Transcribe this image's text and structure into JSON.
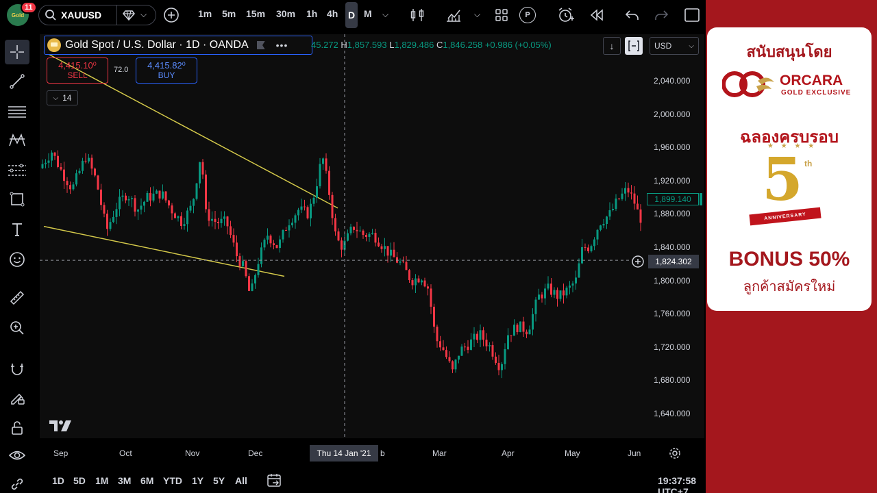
{
  "topbar": {
    "notification_count": "11",
    "avatar_text": "Gold",
    "symbol": "XAUUSD",
    "intervals": [
      "1m",
      "5m",
      "15m",
      "30m",
      "1h",
      "4h",
      "D",
      "M"
    ],
    "active_interval": "D",
    "p_label": "P"
  },
  "legend": {
    "title": "Gold Spot / U.S. Dollar · 1D · OANDA",
    "ohlc_prefix": "45.272",
    "h_label": "H",
    "h_value": "1,857.593",
    "l_label": "L",
    "l_value": "1,829.486",
    "c_label": "C",
    "c_value": "1,846.258",
    "change": "+0.986 (+0.05%)"
  },
  "trade": {
    "sell_price": "4,415.10⁰",
    "sell_label": "SELL",
    "spread": "72.0",
    "buy_price": "4,415.82⁰",
    "buy_label": "BUY",
    "collapsed_count": "14"
  },
  "currency": "USD",
  "chart_data": {
    "type": "candlestick",
    "symbol": "XAUUSD",
    "y_ticks": [
      "2,040.000",
      "2,000.000",
      "1,960.000",
      "1,920.000",
      "1,880.000",
      "1,840.000",
      "1,800.000",
      "1,760.000",
      "1,720.000",
      "1,680.000",
      "1,640.000"
    ],
    "ylim": [
      1610,
      2080
    ],
    "x_ticks": [
      "Sep",
      "Oct",
      "Nov",
      "Dec",
      "Jan",
      "Feb",
      "Mar",
      "Apr",
      "May",
      "Jun"
    ],
    "current_price": "1,899.140",
    "crosshair_price": "1,824.302",
    "crosshair_date": "Thu 14 Jan '21",
    "colors": {
      "up": "#089981",
      "down": "#f23645",
      "trendline": "#d4c94a"
    },
    "trendlines": [
      {
        "from": [
          "Aug",
          2075
        ],
        "to": [
          "Jan",
          1887
        ]
      },
      {
        "from": [
          "Aug",
          1865
        ],
        "to": [
          "Dec",
          1805
        ]
      }
    ]
  },
  "bottombar": {
    "ranges": [
      "1D",
      "5D",
      "1M",
      "3M",
      "6M",
      "YTD",
      "1Y",
      "5Y",
      "All"
    ],
    "clock": "19:37:58 UTC+7"
  },
  "ad": {
    "sponsor": "สนับสนุนโดย",
    "brand": "ORCARA",
    "brand_sub": "GOLD EXCLUSIVE",
    "celebrate": "ฉลองครบรอบ",
    "anniv_number": "5",
    "anniv_suffix": "th",
    "anniv_ribbon": "ANNIVERSARY",
    "bonus": "BONUS 50%",
    "bonus_sub": "ลูกค้าสมัครใหม่"
  }
}
